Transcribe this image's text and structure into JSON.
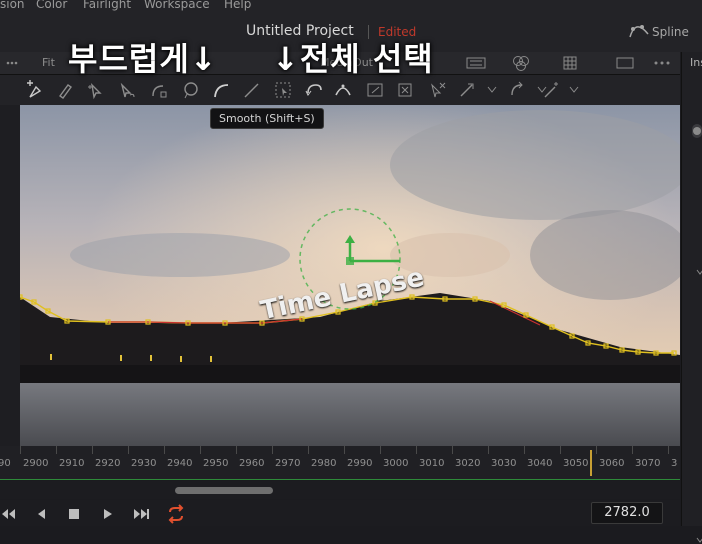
{
  "menu": [
    "sion",
    "Color",
    "Fairlight",
    "Workspace",
    "Help"
  ],
  "title": {
    "project": "Untitled Project",
    "status": "Edited",
    "panel": "Spline"
  },
  "viewer_header": {
    "zoom": "Fit",
    "output": "MediaOut"
  },
  "inspector_label": "Ins",
  "tooltip": "Smooth (Shift+S)",
  "overlays": {
    "smooth": "부드럽게↓",
    "select_all": "↓전체 선택"
  },
  "video_text": "Time Lapse",
  "ruler": {
    "labels": [
      "90",
      "2900",
      "2910",
      "2920",
      "2930",
      "2940",
      "2950",
      "2960",
      "2970",
      "2980",
      "2990",
      "3000",
      "3010",
      "3020",
      "3030",
      "3040",
      "3050",
      "3060",
      "3070",
      "3"
    ]
  },
  "frame_counter": "2782.0",
  "colors": {
    "accent": "#c8a034",
    "edited": "#c0392b",
    "spline": "#e0c020",
    "transform": "#3cb043"
  },
  "icons": [
    "add-point-icon",
    "pen-icon",
    "select-icon",
    "modify-icon",
    "reshape-icon",
    "lasso-icon",
    "smooth-icon",
    "linear-icon",
    "select-all-icon",
    "reverse-icon",
    "shape-icon",
    "crop-icon",
    "delete-icon",
    "deselect-icon",
    "move-icon",
    "rotate-icon",
    "magic-wand-icon"
  ],
  "transport_icons": [
    "first-frame-icon",
    "prev-frame-icon",
    "stop-icon",
    "play-icon",
    "last-frame-icon",
    "loop-icon"
  ]
}
